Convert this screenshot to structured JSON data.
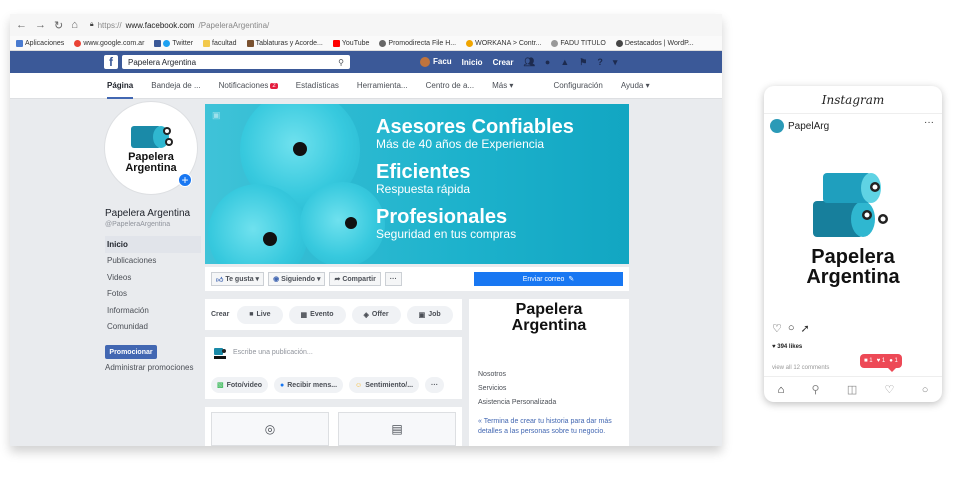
{
  "browser": {
    "url_prefix": "https://",
    "url_host": "www.facebook.com",
    "url_path": "/PapeleraArgentina/",
    "bookmarks": [
      "Aplicaciones",
      "www.google.com.ar",
      "Twitter",
      "facultad",
      "Tablaturas y Acorde...",
      "YouTube",
      "Promodirecta File H...",
      "WORKANA > Contr...",
      "FADU TITULO",
      "Destacados | WordP..."
    ]
  },
  "fb": {
    "search_value": "Papelera Argentina",
    "user_name": "Facu",
    "nav_home": "Inicio",
    "nav_create": "Crear",
    "tabs": [
      "Página",
      "Bandeja de ...",
      "Notificaciones",
      "Estadísticas",
      "Herramienta...",
      "Centro de a...",
      "Más ▾",
      "Configuración",
      "Ayuda ▾"
    ],
    "notif_count": "2"
  },
  "page": {
    "name": "Papelera Argentina",
    "handle": "@PapeleraArgentina",
    "nav": [
      "Inicio",
      "Publicaciones",
      "Videos",
      "Fotos",
      "Información",
      "Comunidad"
    ],
    "promote": "Promocionar",
    "admin_promotions": "Administrar promociones"
  },
  "brand": {
    "line1": "Papelera",
    "line2": "Argentina"
  },
  "cover": {
    "h1": "Asesores Confiables",
    "s1": "Más de 40 años de Experiencia",
    "h2": "Eficientes",
    "s2": "Respuesta rápida",
    "h3": "Profesionales",
    "s3": "Seguridad en tus compras"
  },
  "actions": {
    "like": "Te gusta ▾",
    "following": "Siguiendo ▾",
    "share": "Compartir",
    "more": "···",
    "send_email": "Enviar correo"
  },
  "create": {
    "label": "Crear",
    "live": "Live",
    "event": "Evento",
    "offer": "Offer",
    "job": "Job"
  },
  "post": {
    "placeholder": "Escribe una publicación...",
    "photo_video": "Foto/video",
    "receive_messages": "Recibir mens...",
    "feeling": "Sentimiento/...",
    "more": "···"
  },
  "about": {
    "items": [
      "Nosotros",
      "Servicios",
      "Asistencia Personalizada"
    ],
    "link": "« Termina de crear tu historia para dar más detalles a las personas sobre tu negocio."
  },
  "instagram": {
    "app_title": "Instagram",
    "username": "PapelArg",
    "likes": "394 likes",
    "comments": "view all 12 comments",
    "notif_comments": "1",
    "notif_likes": "1",
    "notif_follows": "1"
  },
  "colors": {
    "fb_blue": "#3b5998",
    "fb_button": "#1877f2",
    "cover_teal": "#1db2cc",
    "ig_red": "#ed4956"
  }
}
